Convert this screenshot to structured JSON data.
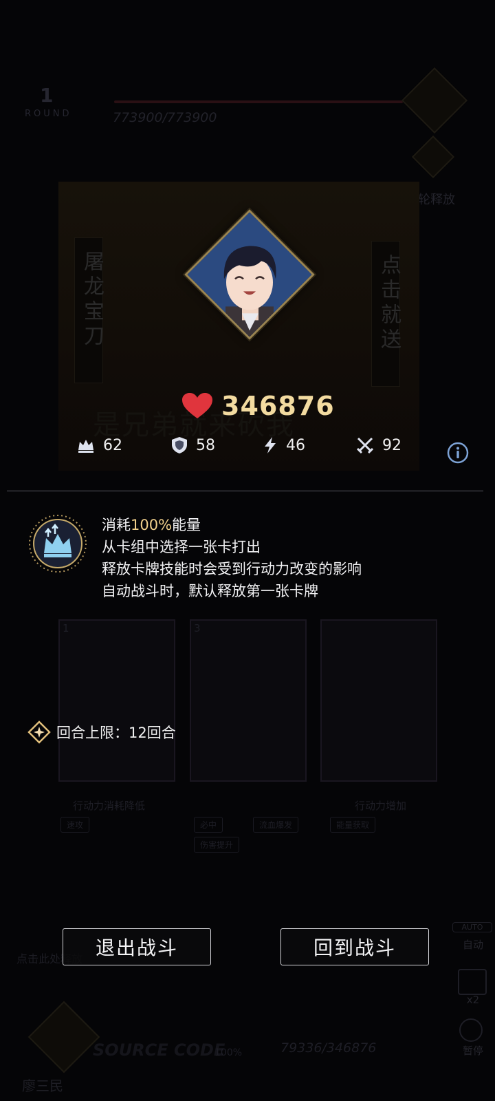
{
  "background": {
    "round_number": "1",
    "round_label": "ROUND",
    "enemy_hp": "773900/773900",
    "next_release_label": "下轮释放",
    "banner_left": "屠龙宝刀",
    "banner_right": "点击就送",
    "slogan": "是兄弟就来砍我",
    "cards": [
      {
        "index": "1",
        "caption": "行动力消耗降低",
        "tags": [
          "速攻"
        ]
      },
      {
        "index": "3",
        "caption": "",
        "tags": [
          "必中",
          "流血爆发",
          "伤害提升"
        ]
      },
      {
        "index": "",
        "caption": "行动力增加",
        "tags": [
          "能量获取"
        ]
      }
    ],
    "auto_label": "自动",
    "speed_label": "x2",
    "pause_label": "暂停",
    "hint": "点击此处释放",
    "player_name": "廖三民",
    "source_code": "SOURCE CODE",
    "energy_pct": "100%",
    "player_hp": "79336/346876"
  },
  "character": {
    "hp": "346876",
    "stats": [
      {
        "icon": "crown-icon",
        "value": "62"
      },
      {
        "icon": "shield-icon",
        "value": "58"
      },
      {
        "icon": "lightning-icon",
        "value": "46"
      },
      {
        "icon": "crossed-swords-icon",
        "value": "92"
      }
    ]
  },
  "skill": {
    "line1_prefix": "消耗",
    "line1_highlight": "100%",
    "line1_suffix": "能量",
    "line2": "从卡组中选择一张卡打出",
    "line3": "释放卡牌技能时会受到行动力改变的影响",
    "line4": "自动战斗时，默认释放第一张卡牌"
  },
  "round_limit": {
    "label": "回合上限：12回合"
  },
  "buttons": {
    "exit": "退出战斗",
    "return": "回到战斗"
  },
  "colors": {
    "accent_gold": "#f0cf8b",
    "heart_red": "#e0353d",
    "info_blue": "#7da3d6"
  }
}
